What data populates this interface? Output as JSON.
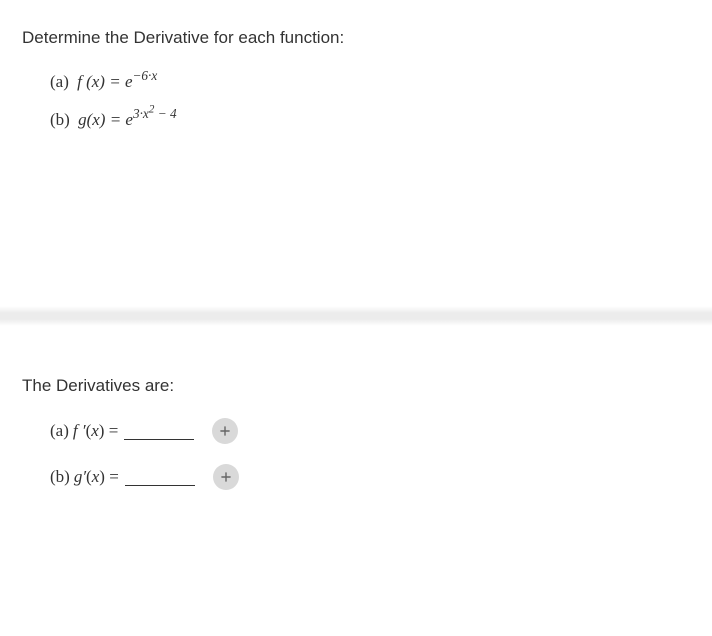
{
  "question": {
    "prompt": "Determine the Derivative for each function:",
    "items": [
      {
        "label": "(a)",
        "lhs": "f (x) =",
        "base": "e",
        "exponent": "−6·x"
      },
      {
        "label": "(b)",
        "lhs": "g(x) =",
        "base": "e",
        "exponent": "3·x² − 4"
      }
    ]
  },
  "answers": {
    "heading": "The Derivatives are:",
    "items": [
      {
        "label": "(a)",
        "func": "f ′(x) =",
        "value": ""
      },
      {
        "label": "(b)",
        "func": "g′(x) =",
        "value": ""
      }
    ]
  },
  "icons": {
    "plus": "+"
  }
}
